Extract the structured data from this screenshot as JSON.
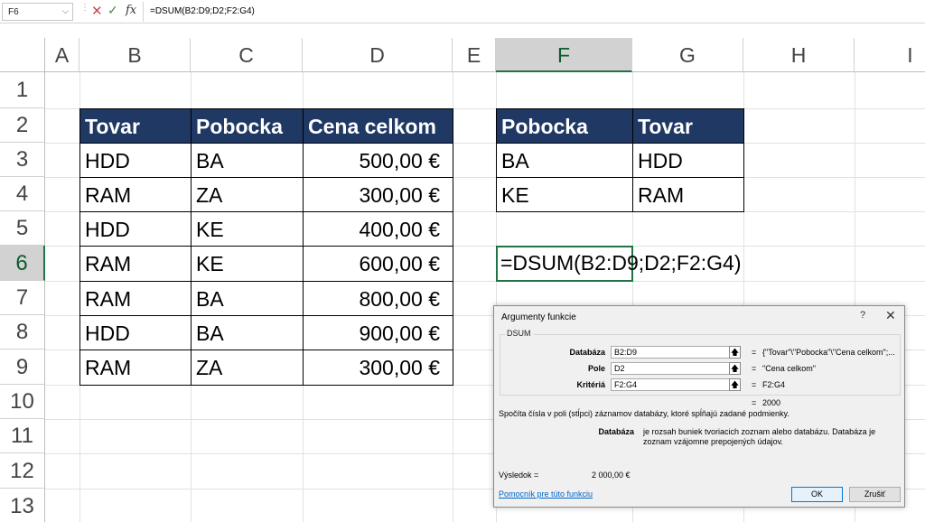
{
  "formula_bar": {
    "name_box": "F6",
    "cancel_icon": "✕",
    "enter_icon": "✓",
    "fx_label": "fx",
    "formula": "=DSUM(B2:D9;D2;F2:G4)"
  },
  "columns": [
    "A",
    "B",
    "C",
    "D",
    "E",
    "F",
    "G",
    "H",
    "I"
  ],
  "selected_column": "F",
  "rows": [
    "1",
    "2",
    "3",
    "4",
    "5",
    "6",
    "7",
    "8",
    "9",
    "10",
    "11",
    "12",
    "13"
  ],
  "selected_row": "6",
  "table1": {
    "headers": [
      "Tovar",
      "Pobocka",
      "Cena celkom"
    ],
    "rows": [
      [
        "HDD",
        "BA",
        "500,00 €"
      ],
      [
        "RAM",
        "ZA",
        "300,00 €"
      ],
      [
        "HDD",
        "KE",
        "400,00 €"
      ],
      [
        "RAM",
        "KE",
        "600,00 €"
      ],
      [
        "RAM",
        "BA",
        "800,00 €"
      ],
      [
        "HDD",
        "BA",
        "900,00 €"
      ],
      [
        "RAM",
        "ZA",
        "300,00 €"
      ]
    ]
  },
  "table2": {
    "headers": [
      "Pobocka",
      "Tovar"
    ],
    "rows": [
      [
        "BA",
        "HDD"
      ],
      [
        "KE",
        "RAM"
      ]
    ]
  },
  "active_cell_text": "=DSUM(B2:D9;D2;F2:G4)",
  "dialog": {
    "title": "Argumenty funkcie",
    "help": "?",
    "close": "✕",
    "function_name": "DSUM",
    "args": [
      {
        "label": "Databáza",
        "value": "B2:D9",
        "result": "{\"Tovar\"\\\"Pobocka\"\\\"Cena celkom\";..."
      },
      {
        "label": "Pole",
        "value": "D2",
        "result": "\"Cena celkom\""
      },
      {
        "label": "Kritériá",
        "value": "F2:G4",
        "result": "F2:G4"
      }
    ],
    "equals": "=",
    "function_result": "2000",
    "description": "Spočíta čísla v poli (stĺpci) záznamov databázy, ktoré spĺňajú zadané podmienky.",
    "arg_help_label": "Databáza",
    "arg_help_text": "je rozsah buniek tvoriacich zoznam alebo databázu. Databáza je zoznam vzájomne prepojených údajov.",
    "result_label": "Výsledok =",
    "result_value": "2 000,00 €",
    "help_link": "Pomocník pre túto funkciu",
    "ok_label": "OK",
    "cancel_label": "Zrušiť"
  }
}
